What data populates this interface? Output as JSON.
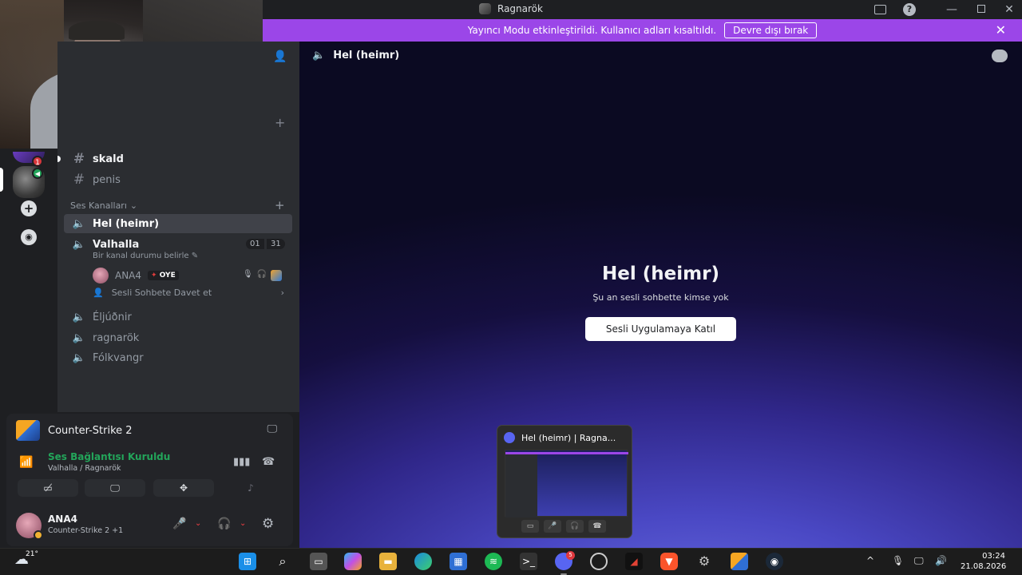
{
  "titlebar": {
    "title": "Ragnarök"
  },
  "banner": {
    "message": "Yayıncı Modu etkinleştirildi. Kullanıcı adları kısaltıldı.",
    "button_label": "Devre dışı bırak"
  },
  "rail": {
    "mention_count": "1"
  },
  "sidebar": {
    "text_channels": [
      {
        "name": "skald"
      },
      {
        "name": "penis"
      }
    ],
    "voice_category": "Ses Kanalları",
    "voice_channels": [
      {
        "name": "Hel (heimr)"
      },
      {
        "name": "Valhalla"
      },
      {
        "name": "Éljúðnir"
      },
      {
        "name": "ragnarök"
      },
      {
        "name": "Fólkvangr"
      }
    ],
    "valhalla": {
      "count_left": "01",
      "count_right": "31",
      "status": "Bir kanal durumu belirle",
      "member_name": "ANA4",
      "member_tag": "OYE",
      "invite": "Sesli Sohbete Davet et"
    }
  },
  "userpanel": {
    "activity": "Counter-Strike 2",
    "voice_status": "Ses Bağlantısı Kuruldu",
    "voice_location": "Valhalla / Ragnarök",
    "username": "ANA4",
    "user_status": "Counter-Strike 2 +1"
  },
  "main": {
    "channel_name": "Hel (heimr)",
    "title": "Hel (heimr)",
    "subtitle": "Şu an sesli sohbette kimse yok",
    "join_button": "Sesli Uygulamaya Katıl"
  },
  "preview": {
    "title": "Hel (heimr) | Ragna..."
  },
  "taskbar": {
    "temperature": "21°",
    "discord_badge": "5",
    "time": "03:24",
    "date": "21.08.2026"
  },
  "colors": {
    "banner": "#9b46e8",
    "voice_connected": "#23a55a",
    "muted": "#f23f43",
    "sidebar_bg": "#2b2d31",
    "rail_bg": "#1e1f22"
  }
}
